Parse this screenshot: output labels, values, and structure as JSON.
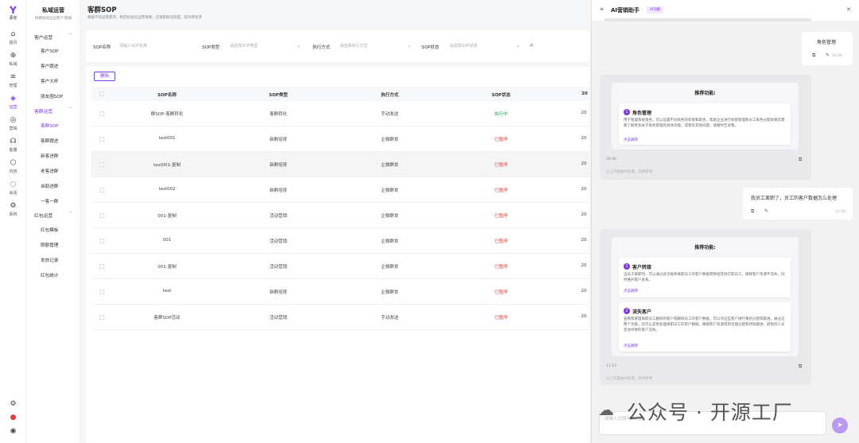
{
  "rail": {
    "logo_text": "源雀",
    "items": [
      {
        "label": "首页",
        "icon": "home-icon"
      },
      {
        "label": "私域",
        "icon": "globe-icon"
      },
      {
        "label": "管理",
        "icon": "layers-icon"
      },
      {
        "label": "运营",
        "icon": "tag-icon",
        "active": true
      },
      {
        "label": "营销",
        "icon": "target-icon"
      },
      {
        "label": "客服",
        "icon": "service-icon"
      },
      {
        "label": "内容",
        "icon": "box-icon"
      },
      {
        "label": "会话",
        "icon": "chat-icon"
      },
      {
        "label": "系统",
        "icon": "gear-icon"
      }
    ]
  },
  "submenu": {
    "title": "私域运营",
    "subtitle": "快捷高效企业客户/客群",
    "groups": [
      {
        "label": "客户运营",
        "items": [
          "客户SOP",
          "客户跟进",
          "客户大杯",
          "朋友圈SOP"
        ]
      },
      {
        "label": "客群运营",
        "items": [
          "客群SOP",
          "客群跟进",
          "新客进群",
          "老客进群",
          "自助进群",
          "一客一群"
        ]
      },
      {
        "label": "红包运营",
        "items": [
          "红包模板",
          "限额管理",
          "发放记录",
          "红包统计"
        ]
      }
    ]
  },
  "page": {
    "title": "客群SOP",
    "description": "根据不同运营需求，制定标准化运营策略，还请客群活跃度，提升转化率",
    "filters": {
      "sop_name_label": "SOP名称",
      "sop_name_placeholder": "请输入SOP名称",
      "sop_type_label": "SOP类型",
      "sop_type_placeholder": "请选择SOP类型",
      "exec_label": "执行方式",
      "exec_placeholder": "请选择执行方式",
      "status_label": "SOP状态",
      "status_placeholder": "请选择SOP状态"
    },
    "delete_label": "删除",
    "columns": [
      "SOP名称",
      "SOP类型",
      "执行方式",
      "SOP状态",
      "20"
    ],
    "rows": [
      {
        "name": "群SOP-客群转化",
        "type": "客群转化",
        "exec": "手动发送",
        "status": "执行中",
        "date": "20"
      },
      {
        "name": "test001",
        "type": "新群培育",
        "exec": "企微群发",
        "status": "已暂停",
        "date": "20"
      },
      {
        "name": "test001-复制",
        "type": "新群培育",
        "exec": "企微群发",
        "status": "已暂停",
        "date": "20"
      },
      {
        "name": "test002",
        "type": "新群培育",
        "exec": "企微群发",
        "status": "已暂停",
        "date": "20"
      },
      {
        "name": "001-复制",
        "type": "活动营销",
        "exec": "企微群发",
        "status": "已暂停",
        "date": "20"
      },
      {
        "name": "001",
        "type": "活动营销",
        "exec": "企微群发",
        "status": "已暂停",
        "date": "20"
      },
      {
        "name": "001-复制",
        "type": "活动营销",
        "exec": "企微群发",
        "status": "已暂停",
        "date": "20"
      },
      {
        "name": "test",
        "type": "新群培育",
        "exec": "企微群发",
        "status": "已暂停",
        "date": "20"
      },
      {
        "name": "客群SOP活动",
        "type": "活动营销",
        "exec": "手动发送",
        "status": "已暂停",
        "date": "20"
      }
    ]
  },
  "panel": {
    "title": "AI营销助手",
    "badge": "AI功能",
    "messages": {
      "user1": {
        "text": "角色管理",
        "time": "20:46"
      },
      "ai1": {
        "heading": "推荐功能:",
        "feature_title": "角色管理",
        "feature_desc": "用于管理系统角色。可以设置不同角色的权限和职责，帮助企业进行权限管理和员工角色分配如果您需要了解更多关于角色管理的具体功能，或者有其他问题，请随时告诉我。",
        "feature_link": "点击跳转",
        "time": "20:46",
        "note": "以上内容由AI生成，仅供参考"
      },
      "user2": {
        "text": "我员工离职了，员工的客户数据怎么处理",
        "time": "11:53"
      },
      "ai2": {
        "heading": "推荐功能:",
        "f1_title": "客户转接",
        "f1_desc": "当员工离职时，可以通过此功能将离职员工的客户数据转移给其他在职员工，确保客户资源不流失，同时维护客户关系。",
        "f1_link": "点击跳转",
        "f2_title": "流失客户",
        "f2_desc": "查看和管理离职员工删除的客户或删除员工的客户数据，可以对这些客户进行重新分配或跟进。通过这两个功能，您可以妥善处理离职员工的客户数据，确保客户资源得到合理分配和持续跟进，避免因人员变动导致的客户流失。",
        "f2_link": "点击跳转",
        "time": "11:53",
        "note": "以上内容由AI生成，仅供参考"
      }
    },
    "input_placeholder": "请输入您想问的问题",
    "watermark": "公众号 · 开源工厂"
  }
}
